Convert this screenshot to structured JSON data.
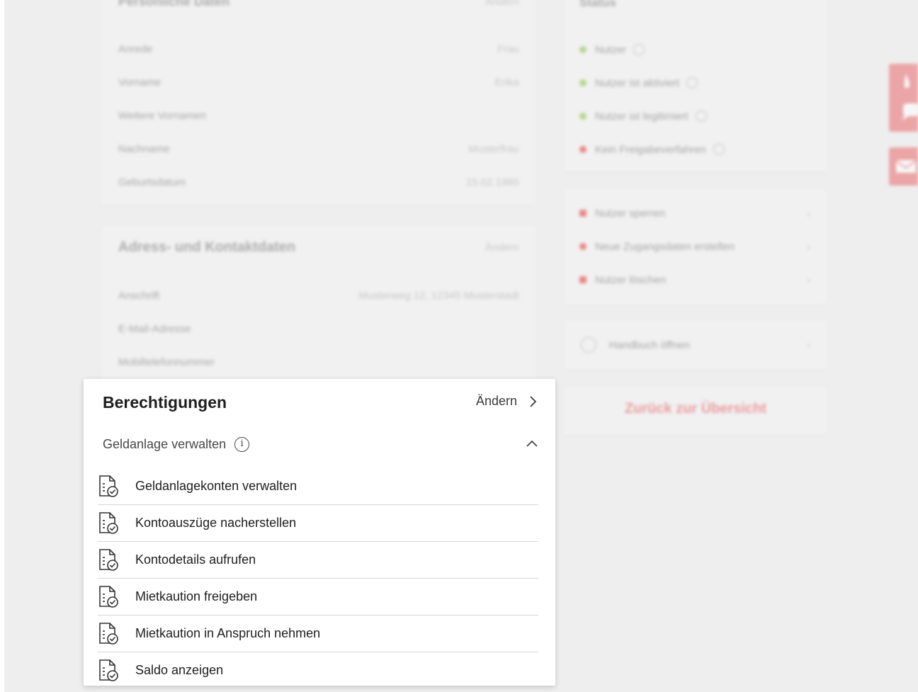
{
  "background": {
    "personal": {
      "title": "Persönliche Daten",
      "action": "Ändern",
      "rows": [
        {
          "label": "Anrede",
          "value": "Frau"
        },
        {
          "label": "Vorname",
          "value": "Erika"
        },
        {
          "label": "Weitere Vornamen",
          "value": ""
        },
        {
          "label": "Nachname",
          "value": "Musterfrau"
        },
        {
          "label": "Geburtsdatum",
          "value": "15.02.1985"
        }
      ]
    },
    "address": {
      "title": "Adress- und Kontaktdaten",
      "action": "Ändern",
      "rows": [
        {
          "label": "Anschrift",
          "value": "Musterweg 12, 12345 Musterstadt"
        },
        {
          "label": "E-Mail-Adresse",
          "value": ""
        },
        {
          "label": "Mobiltelefonnummer",
          "value": ""
        }
      ]
    },
    "status": {
      "title": "Status",
      "items": [
        {
          "label": "Nutzer",
          "color": "#8bc34a"
        },
        {
          "label": "Nutzer ist aktiviert",
          "color": "#8bc34a"
        },
        {
          "label": "Nutzer ist legitimiert",
          "color": "#8bc34a"
        },
        {
          "label": "Kein Freigabeverfahren",
          "color": "#e53935"
        }
      ]
    },
    "actions": [
      {
        "label": "Nutzer sperren"
      },
      {
        "label": "Neue Zugangsdaten erstellen"
      },
      {
        "label": "Nutzer löschen"
      }
    ],
    "manual": {
      "label": "Handbuch öffnen"
    },
    "back": "Zurück zur Übersicht"
  },
  "panel": {
    "title": "Berechtigungen",
    "change_label": "Ändern",
    "section_label": "Geldanlage verwalten",
    "items": [
      {
        "label": "Geldanlagekonten verwalten"
      },
      {
        "label": "Kontoauszüge nacherstellen"
      },
      {
        "label": "Kontodetails aufrufen"
      },
      {
        "label": "Mietkaution freigeben"
      },
      {
        "label": "Mietkaution in Anspruch nehmen"
      },
      {
        "label": "Saldo anzeigen"
      }
    ]
  },
  "colors": {
    "accent": "#e8585c",
    "success": "#8bc34a",
    "danger": "#e53935"
  },
  "icons": {
    "contact": [
      "phone-icon",
      "chat-icon",
      "mail-icon"
    ],
    "permission": "document-check-icon"
  }
}
